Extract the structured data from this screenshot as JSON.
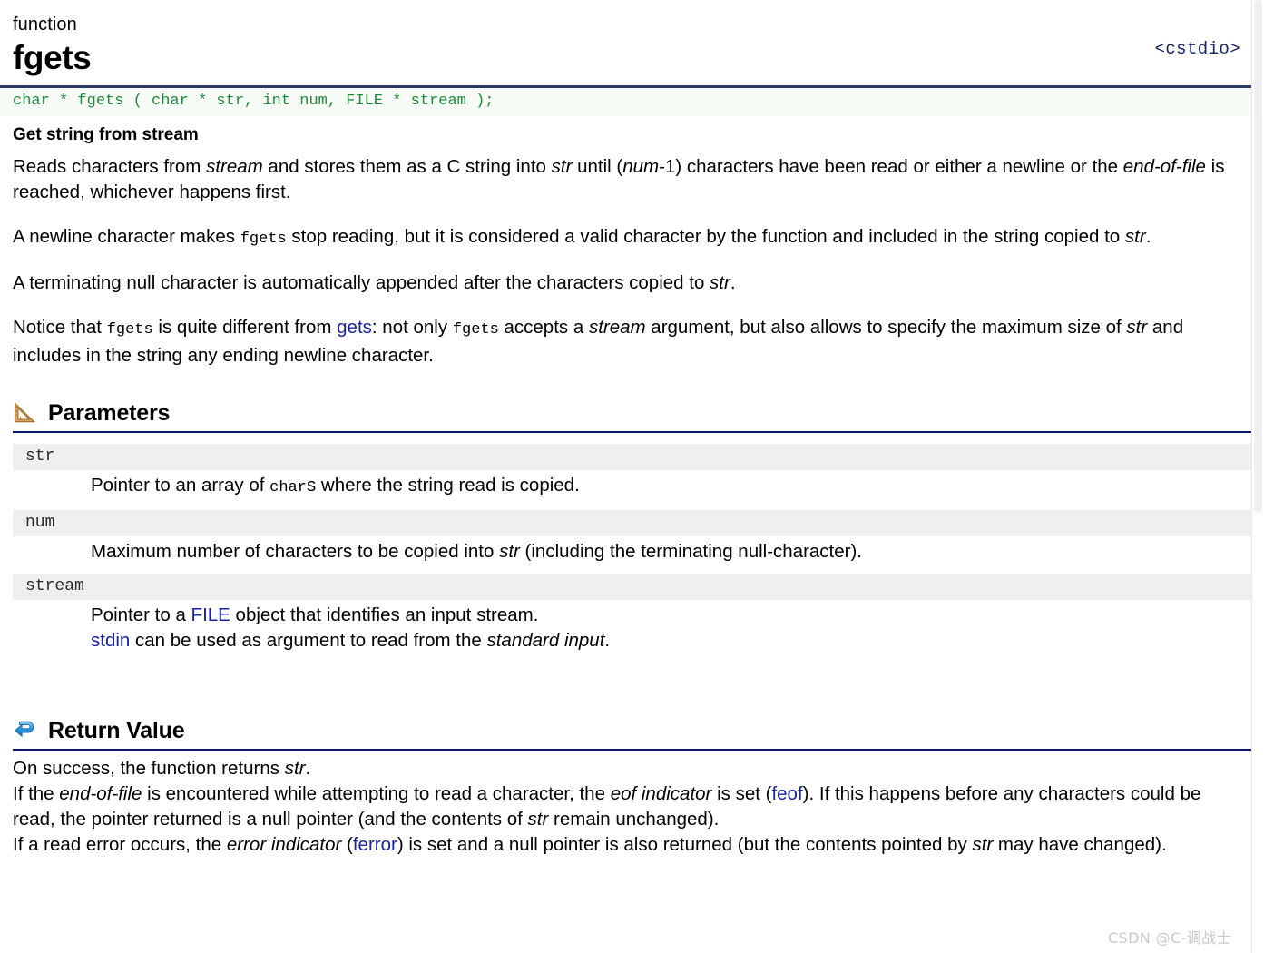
{
  "header": {
    "kind": "function",
    "title": "fgets",
    "include": "<cstdio>",
    "signature": "char * fgets ( char * str, int num, FILE * stream );"
  },
  "brief": "Get string from stream",
  "description": {
    "p1_a": "Reads characters from ",
    "p1_stream": "stream",
    "p1_b": " and stores them as a C string into ",
    "p1_str": "str",
    "p1_c": " until (",
    "p1_num": "num",
    "p1_d": "-1) characters have been read or either a newline or the ",
    "p1_eof": "end-of-file",
    "p1_e": " is reached, whichever happens first.",
    "p2_a": "A newline character makes ",
    "p2_fgets": "fgets",
    "p2_b": " stop reading, but it is considered a valid character by the function and included in the string copied to ",
    "p2_str": "str",
    "p2_c": ".",
    "p3_a": "A terminating null character is automatically appended after the characters copied to ",
    "p3_str": "str",
    "p3_b": ".",
    "p4_a": "Notice that ",
    "p4_fgets1": "fgets",
    "p4_b": " is quite different from ",
    "p4_gets": "gets",
    "p4_c": ": not only ",
    "p4_fgets2": "fgets",
    "p4_d": " accepts a ",
    "p4_stream": "stream",
    "p4_e": " argument, but also allows to specify the maximum size of ",
    "p4_str": "str",
    "p4_f": " and includes in the string any ending newline character."
  },
  "sections": {
    "parameters": {
      "title": "Parameters",
      "icon": "triangle-ruler-icon"
    },
    "return_value": {
      "title": "Return Value",
      "icon": "return-arrow-icon"
    }
  },
  "parameters": [
    {
      "name": "str",
      "desc_a": "Pointer to an array of ",
      "desc_code": "char",
      "desc_b": "s where the string read is copied."
    },
    {
      "name": "num",
      "desc_a": "Maximum number of characters to be copied into ",
      "desc_em": "str",
      "desc_b": " (including the terminating null-character)."
    },
    {
      "name": "stream",
      "desc_a": "Pointer to a ",
      "desc_link1": "FILE",
      "desc_b": " object that identifies an input stream.",
      "desc_link2": "stdin",
      "desc_c": " can be used as argument to read from the ",
      "desc_em": "standard input",
      "desc_d": "."
    }
  ],
  "return_value": {
    "l1_a": "On success, the function returns ",
    "l1_str": "str",
    "l1_b": ".",
    "l2_a": "If the ",
    "l2_eof": "end-of-file",
    "l2_b": " is encountered while attempting to read a character, the ",
    "l2_eofind": "eof indicator",
    "l2_c": " is set (",
    "l2_feof": "feof",
    "l2_d": "). If this happens before any characters could be read, the pointer returned is a null pointer (and the contents of ",
    "l2_str": "str",
    "l2_e": " remain unchanged).",
    "l3_a": "If a read error occurs, the ",
    "l3_errind": "error indicator",
    "l3_b": " (",
    "l3_ferror": "ferror",
    "l3_c": ") is set and a null pointer is also returned (but the contents pointed by ",
    "l3_str": "str",
    "l3_d": " may have changed)."
  },
  "watermark": "CSDN @C-调战士",
  "colors": {
    "rule": "#0d1a63",
    "signature_text": "#1f8a3b",
    "link": "#1a23a0",
    "param_band": "#efefef",
    "include_text": "#16216b"
  }
}
